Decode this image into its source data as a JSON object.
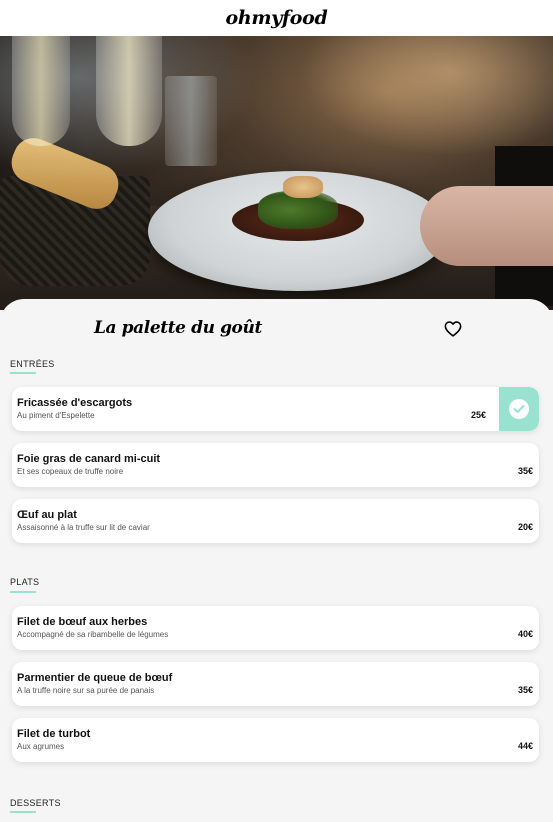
{
  "app": {
    "logo": "ohmyfood"
  },
  "restaurant": {
    "title": "La palette du goût",
    "favorite_icon": "heart-outline-icon"
  },
  "sections": [
    {
      "title": "ENTRÉES",
      "items": [
        {
          "name": "Fricassée d'escargots",
          "desc": "Au piment d'Espelette",
          "price": "25€",
          "selected": true
        },
        {
          "name": "Foie gras de canard mi-cuit",
          "desc": "Et ses copeaux de truffe noire",
          "price": "35€",
          "selected": false
        },
        {
          "name": "Œuf au plat",
          "desc": "Assaisonné à la truffe sur lit de caviar",
          "price": "20€",
          "selected": false
        }
      ]
    },
    {
      "title": "PLATS",
      "items": [
        {
          "name": "Filet de bœuf aux herbes",
          "desc": "Accompagné de sa ribambelle de légumes",
          "price": "40€",
          "selected": false
        },
        {
          "name": "Parmentier de queue de bœuf",
          "desc": "A la truffe noire sur sa purée de panais",
          "price": "35€",
          "selected": false
        },
        {
          "name": "Filet de turbot",
          "desc": "Aux agrumes",
          "price": "44€",
          "selected": false
        }
      ]
    },
    {
      "title": "DESSERTS",
      "items": []
    }
  ],
  "colors": {
    "accent": "#99e2d0",
    "background": "#f5f5f5"
  }
}
